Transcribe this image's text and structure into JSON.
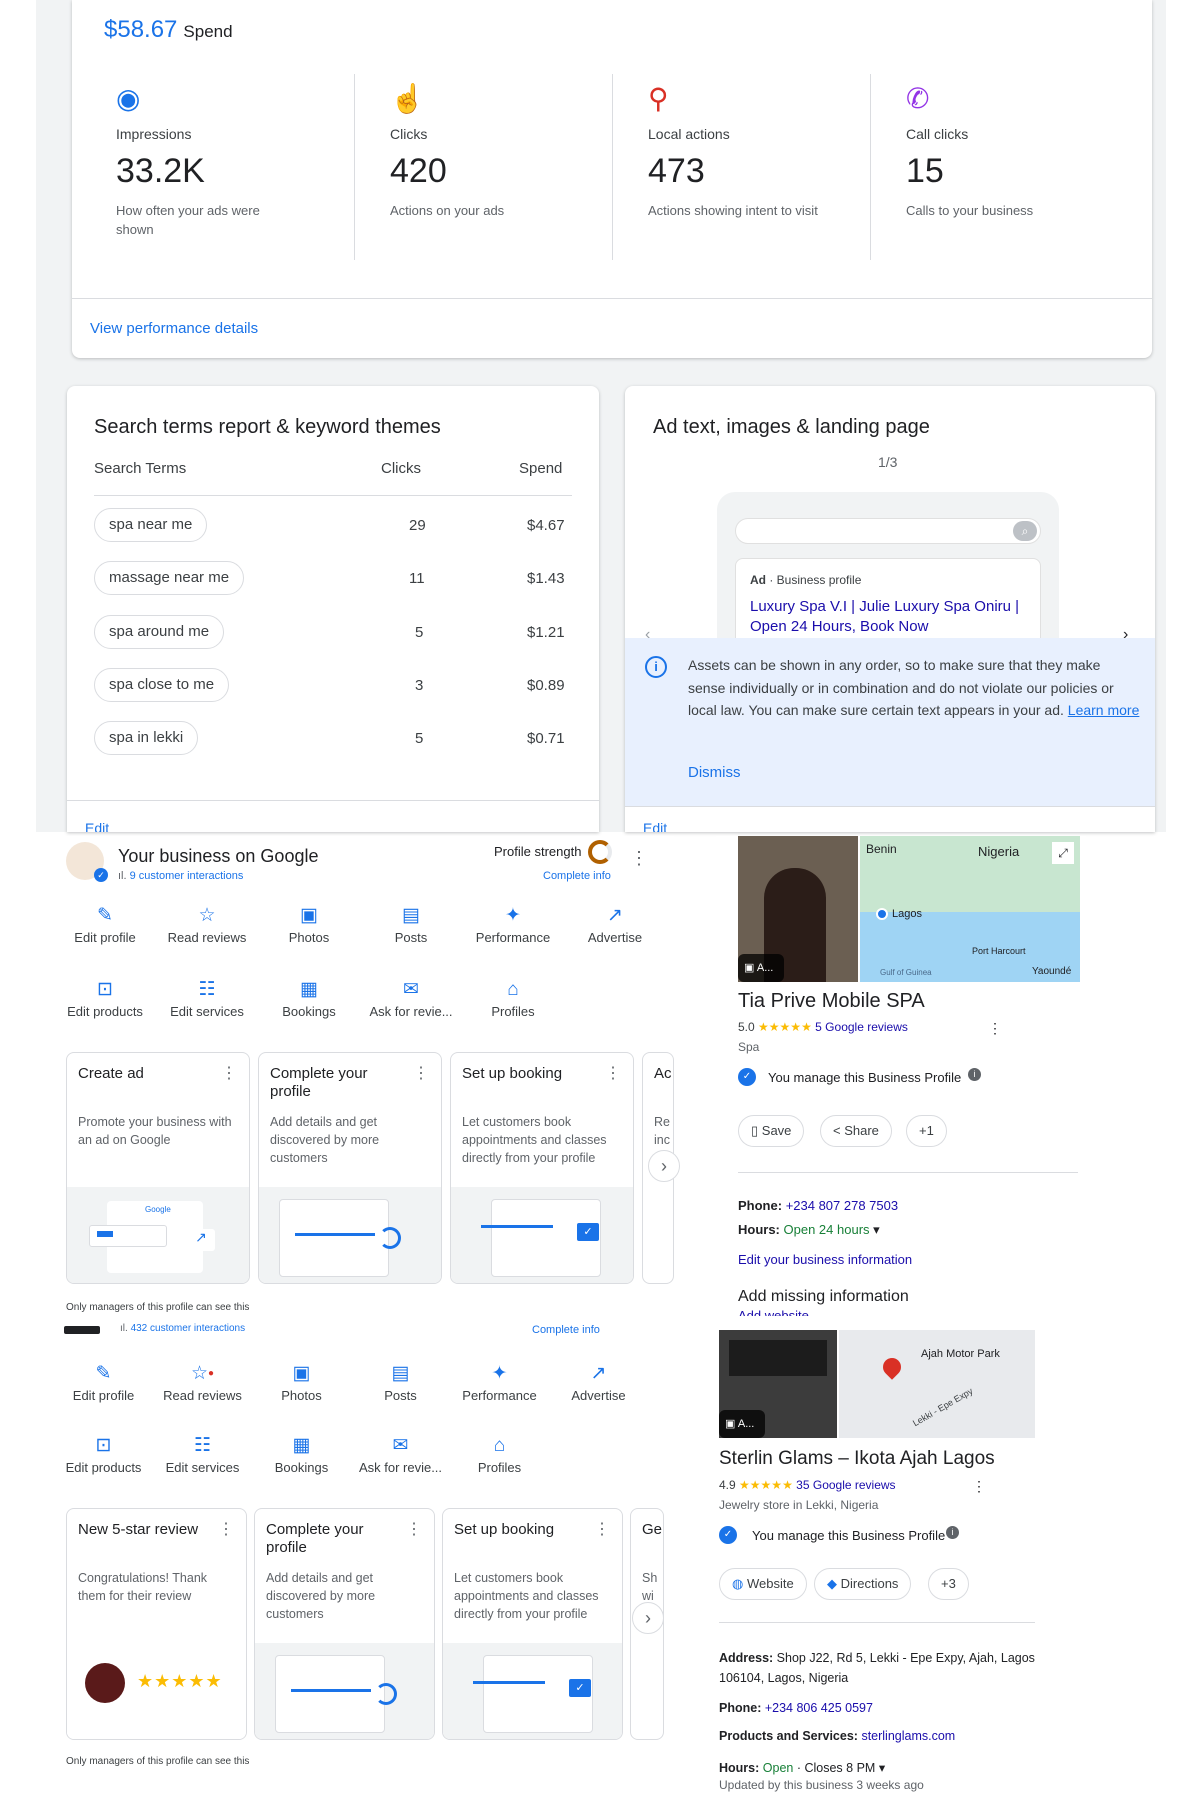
{
  "overview": {
    "spend_value": "$58.67",
    "spend_label": "Spend",
    "view_details": "View performance details",
    "metrics": [
      {
        "icon": "eye-icon",
        "label": "Impressions",
        "value": "33.2K",
        "desc": "How often your ads were shown"
      },
      {
        "icon": "tap-icon",
        "label": "Clicks",
        "value": "420",
        "desc": "Actions on your ads"
      },
      {
        "icon": "location-pin-icon",
        "label": "Local actions",
        "value": "473",
        "desc": "Actions showing intent to visit"
      },
      {
        "icon": "phone-call-icon",
        "label": "Call clicks",
        "value": "15",
        "desc": "Calls to your business"
      }
    ]
  },
  "search_terms": {
    "title": "Search terms report & keyword themes",
    "col_term": "Search Terms",
    "col_clicks": "Clicks",
    "col_spend": "Spend",
    "rows": [
      {
        "term": "spa near me",
        "clicks": "29",
        "spend": "$4.67"
      },
      {
        "term": "massage near me",
        "clicks": "11",
        "spend": "$1.43"
      },
      {
        "term": "spa around me",
        "clicks": "5",
        "spend": "$1.21"
      },
      {
        "term": "spa close to me",
        "clicks": "3",
        "spend": "$0.89"
      },
      {
        "term": "spa in lekki",
        "clicks": "5",
        "spend": "$0.71"
      }
    ],
    "edit": "Edit"
  },
  "ad_preview": {
    "title": "Ad text, images & landing page",
    "pager": "1/3",
    "ad_label": "Ad",
    "ad_source": "Business profile",
    "ad_headline": "Luxury Spa V.I | Julie Luxury Spa Oniru | Open 24 Hours, Book Now",
    "info_text": "Assets can be shown in any order, so to make sure that they make sense individually or in combination and do not violate our policies or local law. You can make sure certain text appears in your ad.",
    "learn_more": "Learn more",
    "dismiss": "Dismiss",
    "edit": "Edit"
  },
  "business1": {
    "title": "Your business on Google",
    "interactions": "9 customer interactions",
    "profile_strength": "Profile strength",
    "complete_info": "Complete info",
    "actions_row1": [
      "Edit profile",
      "Read reviews",
      "Photos",
      "Posts",
      "Performance",
      "Advertise"
    ],
    "actions_row2": [
      "Edit products",
      "Edit services",
      "Bookings",
      "Ask for revie...",
      "Profiles"
    ],
    "cards": [
      {
        "title": "Create ad",
        "desc": "Promote your business with an ad on Google",
        "ill_text": "Google"
      },
      {
        "title": "Complete your profile",
        "desc": "Add details and get discovered by more customers"
      },
      {
        "title": "Set up booking",
        "desc": "Let customers book appointments and classes directly from your profile"
      },
      {
        "title": "Ac",
        "desc": "Re inc"
      }
    ],
    "footnote": "Only managers of this profile can see this"
  },
  "business2": {
    "interactions": "432 customer interactions",
    "complete_info": "Complete info",
    "actions_row1": [
      "Edit profile",
      "Read reviews",
      "Photos",
      "Posts",
      "Performance",
      "Advertise"
    ],
    "actions_row2": [
      "Edit products",
      "Edit services",
      "Bookings",
      "Ask for revie...",
      "Profiles"
    ],
    "cards": [
      {
        "title": "New 5-star review",
        "desc": "Congratulations! Thank them for their review",
        "stars": "★★★★★"
      },
      {
        "title": "Complete your profile",
        "desc": "Add details and get discovered by more customers"
      },
      {
        "title": "Set up booking",
        "desc": "Let customers book appointments and classes directly from your profile"
      },
      {
        "title": "Ge",
        "desc": "Sh wi"
      }
    ],
    "footnote": "Only managers of this profile can see this"
  },
  "listing1": {
    "name": "Tia Prive Mobile SPA",
    "rating": "5.0",
    "stars": "★★★★★",
    "reviews": "5 Google reviews",
    "category": "Spa",
    "manage": "You manage this Business Profile",
    "save": "Save",
    "share": "Share",
    "more": "+1",
    "photo_chip": "A...",
    "map_labels": [
      "Benin",
      "Nigeria",
      "Lagos",
      "Port Harcourt",
      "Gulf of Guinea",
      "Yaoundé"
    ],
    "phone_label": "Phone:",
    "phone": "+234 807 278 7503",
    "hours_label": "Hours:",
    "hours": "Open 24 hours",
    "edit_info": "Edit your business information",
    "missing": "Add missing information",
    "add_website": "Add website"
  },
  "listing2": {
    "name": "Sterlin Glams – Ikota Ajah Lagos",
    "rating": "4.9",
    "stars": "★★★★★",
    "reviews": "35 Google reviews",
    "category": "Jewelry store in Lekki, Nigeria",
    "manage": "You manage this Business Profile",
    "website": "Website",
    "directions": "Directions",
    "more": "+3",
    "photo_chip": "A...",
    "map_labels": [
      "Ajah Motor Park",
      "Lekki - Epe Expy"
    ],
    "address_label": "Address:",
    "address": "Shop J22, Rd 5, Lekki - Epe Expy, Ajah, Lagos 106104, Lagos, Nigeria",
    "phone_label": "Phone:",
    "phone": "+234 806 425 0597",
    "products_label": "Products and Services:",
    "products": "sterlinglams.com",
    "hours_label": "Hours:",
    "hours_open": "Open",
    "hours_close": "· Closes 8 PM",
    "updated": "Updated by this business 3 weeks ago"
  },
  "colors": {
    "accent": "#1a73e8",
    "info_bg": "#e8f0fe",
    "star": "#fbbc04",
    "verified": "#1a73e8"
  }
}
